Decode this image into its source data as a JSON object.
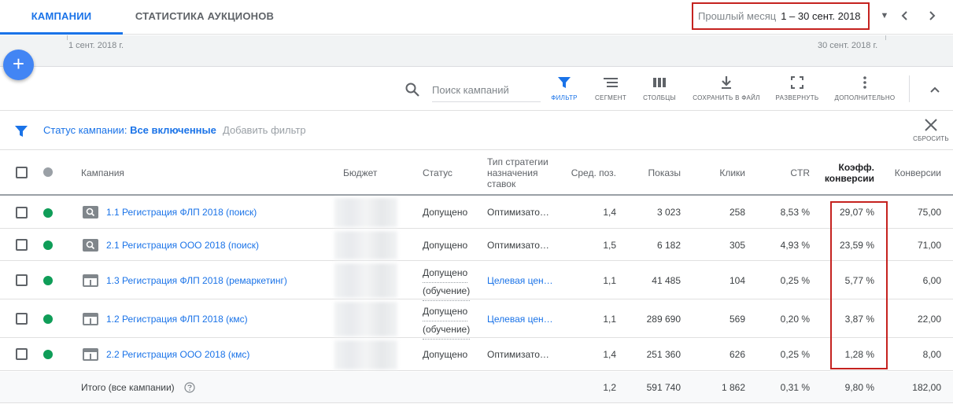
{
  "tabs": [
    {
      "label": "КАМПАНИИ",
      "active": true
    },
    {
      "label": "СТАТИСТИКА АУКЦИОНОВ",
      "active": false
    }
  ],
  "date_range": {
    "label": "Прошлый месяц",
    "value": "1 – 30 сент. 2018"
  },
  "timeline": {
    "start": "1 сент. 2018 г.",
    "end": "30 сент. 2018 г."
  },
  "fab_label": "+",
  "toolbar": {
    "search_placeholder": "Поиск кампаний",
    "tools": [
      "ФИЛЬТР",
      "СЕГМЕНТ",
      "СТОЛБЦЫ",
      "СОХРАНИТЬ В ФАЙЛ",
      "РАЗВЕРНУТЬ",
      "ДОПОЛНИТЕЛЬНО"
    ]
  },
  "filter": {
    "chip_prefix": "Статус кампании:",
    "chip_value": "Все включенные",
    "add_label": "Добавить фильтр",
    "reset_label": "СБРОСИТЬ"
  },
  "columns": {
    "campaign": "Кампания",
    "budget": "Бюджет",
    "status": "Статус",
    "strategy_1": "Тип стратегии",
    "strategy_2": "назначения",
    "strategy_3": "ставок",
    "avg_pos": "Сред. поз.",
    "impressions": "Показы",
    "clicks": "Клики",
    "ctr": "CTR",
    "conv_rate_1": "Коэфф.",
    "conv_rate_2": "конверсии",
    "conversions": "Конверсии"
  },
  "rows": [
    {
      "name": "1.1 Регистрация ФЛП 2018 (поиск)",
      "type": "search",
      "status": "Допущено",
      "status2": "",
      "strategy": "Оптимизато…",
      "strategy_link": false,
      "avg_pos": "1,4",
      "impressions": "3 023",
      "clicks": "258",
      "ctr": "8,53 %",
      "conv_rate": "29,07 %",
      "conversions": "75,00"
    },
    {
      "name": "2.1 Регистрация ООО 2018 (поиск)",
      "type": "search",
      "status": "Допущено",
      "status2": "",
      "strategy": "Оптимизато…",
      "strategy_link": false,
      "avg_pos": "1,5",
      "impressions": "6 182",
      "clicks": "305",
      "ctr": "4,93 %",
      "conv_rate": "23,59 %",
      "conversions": "71,00"
    },
    {
      "name": "1.3 Регистрация ФЛП 2018 (ремаркетинг)",
      "type": "display",
      "status": "Допущено",
      "status2": "(обучение)",
      "strategy": "Целевая цен…",
      "strategy_link": true,
      "avg_pos": "1,1",
      "impressions": "41 485",
      "clicks": "104",
      "ctr": "0,25 %",
      "conv_rate": "5,77 %",
      "conversions": "6,00"
    },
    {
      "name": "1.2 Регистрация ФЛП 2018 (кмс)",
      "type": "display",
      "status": "Допущено",
      "status2": "(обучение)",
      "strategy": "Целевая цен…",
      "strategy_link": true,
      "avg_pos": "1,1",
      "impressions": "289 690",
      "clicks": "569",
      "ctr": "0,20 %",
      "conv_rate": "3,87 %",
      "conversions": "22,00"
    },
    {
      "name": "2.2 Регистрация ООО 2018 (кмс)",
      "type": "display",
      "status": "Допущено",
      "status2": "",
      "strategy": "Оптимизато…",
      "strategy_link": false,
      "avg_pos": "1,4",
      "impressions": "251 360",
      "clicks": "626",
      "ctr": "0,25 %",
      "conv_rate": "1,28 %",
      "conversions": "8,00"
    }
  ],
  "totals": {
    "label": "Итого (все кампании)",
    "avg_pos": "1,2",
    "impressions": "591 740",
    "clicks": "1 862",
    "ctr": "0,31 %",
    "conv_rate": "9,80 %",
    "conversions": "182,00"
  },
  "colors": {
    "accent": "#1a73e8",
    "highlight": "#c5221f",
    "status_ok": "#0f9d58"
  }
}
